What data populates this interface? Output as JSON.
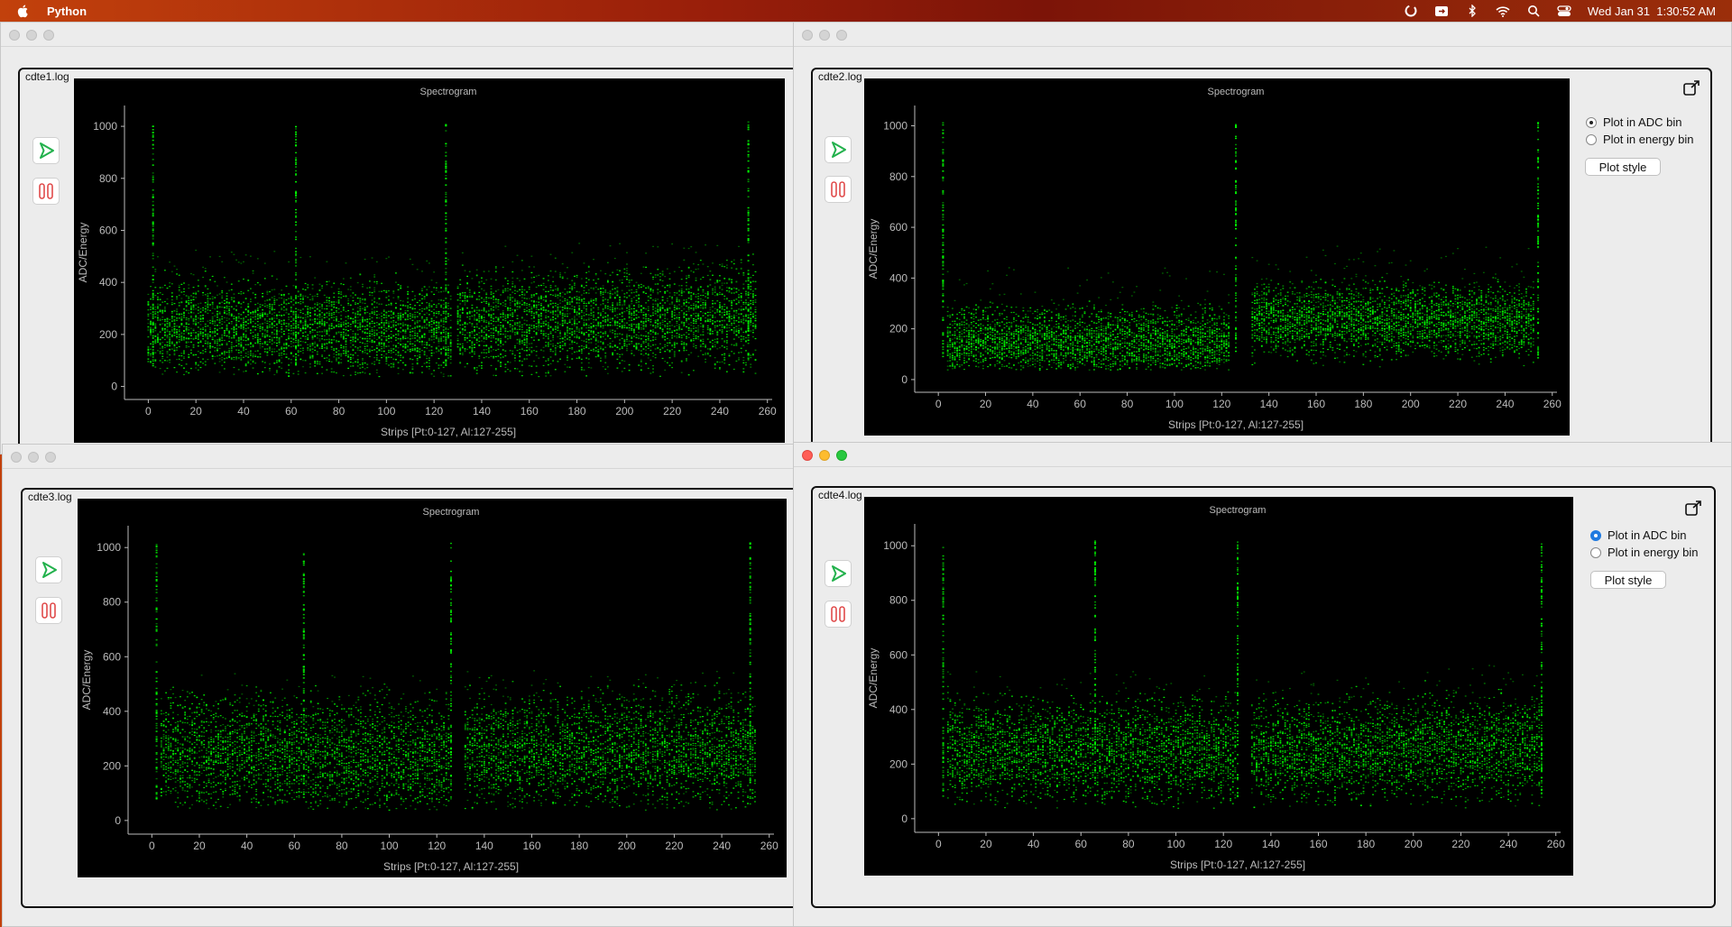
{
  "menubar": {
    "app_name": "Python",
    "clock": "Wed Jan 31  1:30:52 AM",
    "icons": [
      "apple-icon",
      "sync-icon",
      "screen-share-icon",
      "bluetooth-icon",
      "wifi-icon",
      "search-icon",
      "control-center-icon"
    ]
  },
  "windows": [
    {
      "file": "cdte1.log",
      "plot_title": "Spectrogram",
      "x_label": "Strips [Pt:0-127, Al:127-255]",
      "y_label": "ADC/Energy",
      "has_side_controls": false
    },
    {
      "file": "cdte2.log",
      "plot_title": "Spectrogram",
      "x_label": "Strips [Pt:0-127, Al:127-255]",
      "y_label": "ADC/Energy",
      "has_side_controls": true,
      "radio_adc": "Plot in ADC bin",
      "radio_energy": "Plot in energy bin",
      "plot_style": "Plot style"
    },
    {
      "file": "cdte3.log",
      "plot_title": "Spectrogram",
      "x_label": "Strips [Pt:0-127, Al:127-255]",
      "y_label": "ADC/Energy",
      "has_side_controls": false
    },
    {
      "file": "cdte4.log",
      "plot_title": "Spectrogram",
      "x_label": "Strips [Pt:0-127, Al:127-255]",
      "y_label": "ADC/Energy",
      "has_side_controls": true,
      "radio_adc": "Plot in ADC bin",
      "radio_energy": "Plot in energy bin",
      "plot_style": "Plot style"
    }
  ],
  "chart_data": [
    {
      "type": "heatmap",
      "title": "Spectrogram",
      "xlabel": "Strips [Pt:0-127, Al:127-255]",
      "ylabel": "ADC/Energy",
      "xlim": [
        -10,
        262
      ],
      "ylim": [
        -50,
        1080
      ],
      "x_ticks": [
        "0",
        "20",
        "40",
        "60",
        "80",
        "100",
        "120",
        "140",
        "160",
        "180",
        "200",
        "220",
        "240",
        "260"
      ],
      "y_ticks": [
        "0",
        "200",
        "400",
        "600",
        "800",
        "1000"
      ],
      "color": "#00ff00",
      "bands": [
        {
          "x": [
            0,
            127
          ],
          "y_center": [
            230,
            210
          ],
          "spread": 90
        },
        {
          "x": [
            130,
            255
          ],
          "y_center": [
            240,
            270
          ],
          "spread": 100
        }
      ],
      "hot_columns": [
        2,
        62,
        125,
        252
      ]
    },
    {
      "type": "heatmap",
      "title": "Spectrogram",
      "xlabel": "Strips [Pt:0-127, Al:127-255]",
      "ylabel": "ADC/Energy",
      "xlim": [
        -10,
        262
      ],
      "ylim": [
        -50,
        1080
      ],
      "x_ticks": [
        "0",
        "20",
        "40",
        "60",
        "80",
        "100",
        "120",
        "140",
        "160",
        "180",
        "200",
        "220",
        "240",
        "260"
      ],
      "y_ticks": [
        "0",
        "200",
        "400",
        "600",
        "800",
        "1000"
      ],
      "color": "#00ff00",
      "bands": [
        {
          "x": [
            4,
            123
          ],
          "y_center": [
            150,
            145
          ],
          "spread": 70
        },
        {
          "x": [
            133,
            252
          ],
          "y_center": [
            240,
            230
          ],
          "spread": 75
        }
      ],
      "hot_columns": [
        2,
        126,
        254
      ]
    },
    {
      "type": "heatmap",
      "title": "Spectrogram",
      "xlabel": "Strips [Pt:0-127, Al:127-255]",
      "ylabel": "ADC/Energy",
      "xlim": [
        -10,
        262
      ],
      "ylim": [
        -50,
        1080
      ],
      "x_ticks": [
        "0",
        "20",
        "40",
        "60",
        "80",
        "100",
        "120",
        "140",
        "160",
        "180",
        "200",
        "220",
        "240",
        "260"
      ],
      "y_ticks": [
        "0",
        "200",
        "400",
        "600",
        "800",
        "1000"
      ],
      "color": "#00ff00",
      "bands": [
        {
          "x": [
            4,
            125
          ],
          "y_center": [
            250,
            230
          ],
          "spread": 110
        },
        {
          "x": [
            132,
            254
          ],
          "y_center": [
            250,
            260
          ],
          "spread": 110
        }
      ],
      "hot_columns": [
        2,
        64,
        126,
        252
      ]
    },
    {
      "type": "heatmap",
      "title": "Spectrogram",
      "xlabel": "Strips [Pt:0-127, Al:127-255]",
      "ylabel": "ADC/Energy",
      "xlim": [
        -10,
        262
      ],
      "ylim": [
        -50,
        1080
      ],
      "x_ticks": [
        "0",
        "20",
        "40",
        "60",
        "80",
        "100",
        "120",
        "140",
        "160",
        "180",
        "200",
        "220",
        "240",
        "260"
      ],
      "y_ticks": [
        "0",
        "200",
        "400",
        "600",
        "800",
        "1000"
      ],
      "color": "#00ff00",
      "bands": [
        {
          "x": [
            4,
            125
          ],
          "y_center": [
            250,
            240
          ],
          "spread": 95
        },
        {
          "x": [
            132,
            254
          ],
          "y_center": [
            240,
            270
          ],
          "spread": 95
        }
      ],
      "hot_columns": [
        2,
        66,
        126,
        254
      ]
    }
  ]
}
